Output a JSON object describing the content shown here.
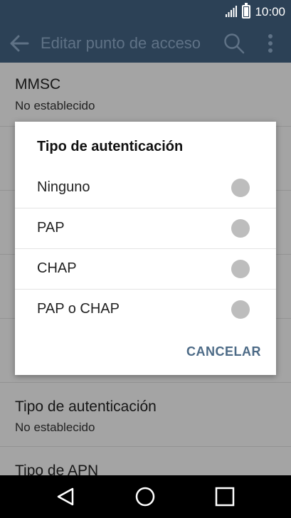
{
  "status_bar": {
    "time": "10:00"
  },
  "app_bar": {
    "title": "Editar punto de acceso"
  },
  "settings": [
    {
      "label": "MMSC",
      "value": "No establecido"
    },
    {
      "label": "",
      "value": ""
    },
    {
      "label": "",
      "value": ""
    },
    {
      "label": "",
      "value": ""
    },
    {
      "label": "Tipo de autenticación",
      "value": "No establecido"
    },
    {
      "label": "Tipo de APN",
      "value": ""
    }
  ],
  "dialog": {
    "title": "Tipo de autenticación",
    "options": [
      {
        "label": "Ninguno",
        "selected": false
      },
      {
        "label": "PAP",
        "selected": false
      },
      {
        "label": "CHAP",
        "selected": false
      },
      {
        "label": "PAP o CHAP",
        "selected": false
      }
    ],
    "cancel_label": "CANCELAR"
  },
  "colors": {
    "primary": "#2c4156",
    "accent": "#4c6a86",
    "radio_off": "#bdbdbd"
  }
}
